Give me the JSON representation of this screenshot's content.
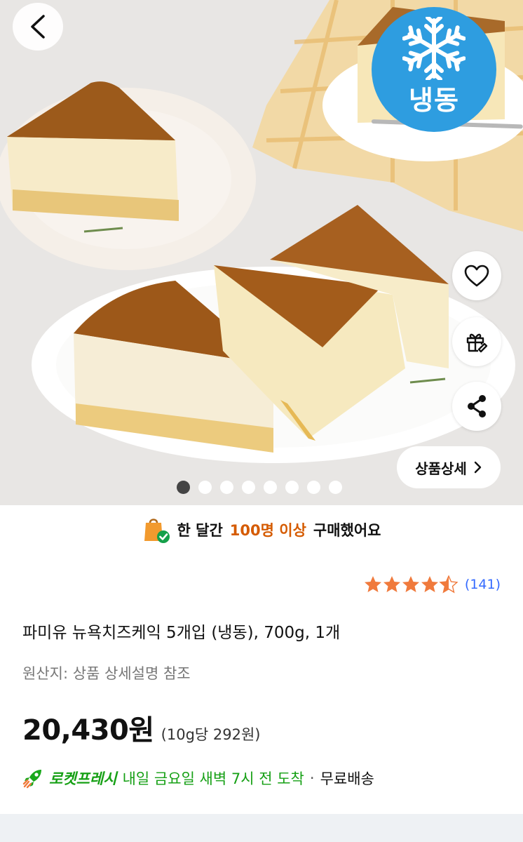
{
  "hero": {
    "badge_label": "냉동",
    "detail_button_label": "상품상세",
    "image_count": 8,
    "active_image_index": 0
  },
  "purchase_info": {
    "prefix": "한 달간",
    "highlight": "100명 이상",
    "suffix": "구매했어요"
  },
  "rating": {
    "stars": 4.5,
    "count_text": "(141)"
  },
  "product": {
    "title": "파미유 뉴욕치즈케익 5개입 (냉동), 700g, 1개",
    "origin": "원산지: 상품 상세설명 참조",
    "price": "20,430원",
    "unit_price": "(10g당 292원)"
  },
  "delivery": {
    "service": "로켓프레시",
    "eta": "내일 금요일 새벽 7시 전 도착",
    "separator": "·",
    "shipping": "무료배송"
  },
  "colors": {
    "badge_blue": "#2e9de0",
    "highlight_orange": "#d55b00",
    "rocket_green": "#16a015",
    "star_orange": "#f07a3c",
    "link_blue": "#346aff"
  },
  "icons": [
    "back-arrow-icon",
    "snowflake-icon",
    "heart-icon",
    "gift-icon",
    "share-icon",
    "chevron-right-icon",
    "shopping-bag-check-icon",
    "star-icon",
    "rocket-icon"
  ]
}
